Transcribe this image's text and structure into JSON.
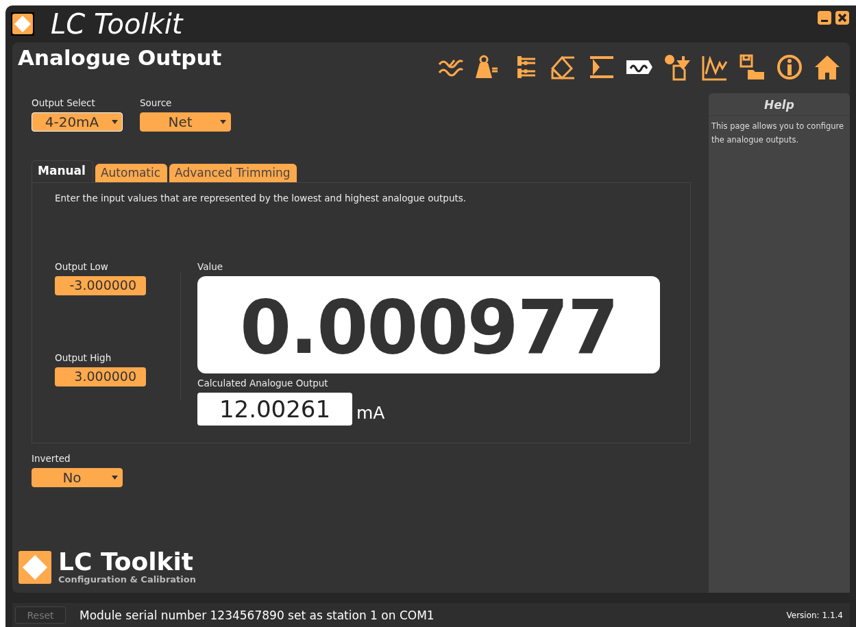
{
  "window": {
    "title": "LC Toolkit"
  },
  "page_title": "Analogue Output",
  "toolbar": [
    {
      "selected": false
    },
    {
      "selected": false
    },
    {
      "selected": false
    },
    {
      "selected": false
    },
    {
      "selected": false
    },
    {
      "selected": true
    },
    {
      "selected": false
    },
    {
      "selected": false
    },
    {
      "selected": false
    },
    {
      "selected": false
    },
    {
      "selected": false
    }
  ],
  "selectors": [
    {
      "label": "Output Select",
      "value": "4-20mA",
      "focused": true
    },
    {
      "label": "Source",
      "value": "Net",
      "focused": false
    }
  ],
  "tabs": [
    {
      "label": "Manual",
      "selected": true
    },
    {
      "label": "Automatic",
      "selected": false
    },
    {
      "label": "Advanced Trimming",
      "selected": false
    }
  ],
  "manual": {
    "instruction": "Enter the input values that are represented by the lowest and highest analogue outputs.",
    "output_low": {
      "label": "Output Low",
      "value": "-3.000000"
    },
    "output_high": {
      "label": "Output High",
      "value": "3.000000"
    },
    "value": {
      "label": "Value",
      "reading": "0.000977"
    },
    "calculated": {
      "label": "Calculated Analogue Output",
      "reading": "12.00261",
      "unit": "mA"
    }
  },
  "inverted": {
    "label": "Inverted",
    "value": "No"
  },
  "logo": {
    "name": "LC Toolkit",
    "tagline": "Configuration & Calibration"
  },
  "help": {
    "title": "Help",
    "text": "This page allows you to configure the analogue outputs."
  },
  "status_bar": {
    "reset_button": {
      "label": "Reset",
      "disabled": true
    },
    "message": "Module serial number 1234567890 set as station 1 on COM1",
    "version": "Version: 1.1.4"
  }
}
